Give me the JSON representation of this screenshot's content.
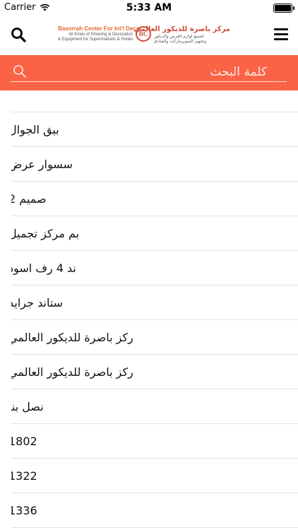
{
  "status_bar": {
    "carrier": "Carrier",
    "time": "5:33 AM"
  },
  "header": {
    "logo": {
      "en_title": "Basorrah Center For Int'l Decor",
      "en_line1": "All Kinds of Showing & Decoration",
      "en_line2": "& Equipment for Supermarkets & Hotels",
      "mark": "BC",
      "ar_title": "مركز باصرة للديكور العالمي",
      "ar_line1": "لجميع لوازم العرض والديكور",
      "ar_line2": "وتجهيز السوبرماركت والفنادق"
    }
  },
  "search": {
    "placeholder": "كلمة البحث",
    "value": ""
  },
  "list": {
    "items": [
      {
        "label": ""
      },
      {
        "label": "بيق الجوال"
      },
      {
        "label": "سسوار عرض"
      },
      {
        "label": "صميم 2"
      },
      {
        "label": "بم مركز تجميل"
      },
      {
        "label": "ند 4 رف اسود"
      },
      {
        "label": "ستاند جرايد"
      },
      {
        "label": "ركز باصرة للديكور العالمي"
      },
      {
        "label": "ركز باصرة للديكور العالمي"
      },
      {
        "label": "نصل بنا"
      },
      {
        "label": "1802"
      },
      {
        "label": "1322"
      },
      {
        "label": "1336"
      }
    ]
  },
  "colors": {
    "accent": "#fa6346",
    "divider": "#e2e2e2",
    "logo_red": "#d24a3a"
  }
}
